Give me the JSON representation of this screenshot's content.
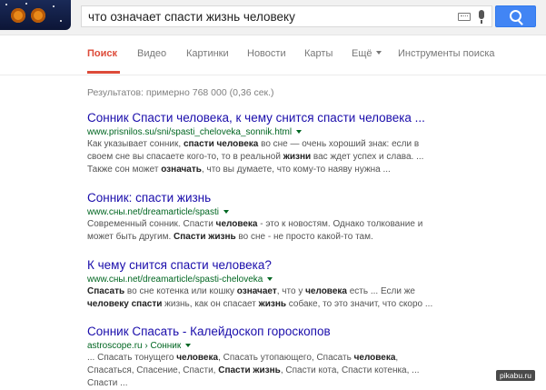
{
  "search": {
    "query": "что означает спасти жизнь человеку"
  },
  "tabs": [
    {
      "label": "Поиск"
    },
    {
      "label": "Видео"
    },
    {
      "label": "Картинки"
    },
    {
      "label": "Новости"
    },
    {
      "label": "Карты"
    },
    {
      "label": "Ещё"
    },
    {
      "label": "Инструменты поиска"
    }
  ],
  "stats": "Результатов: примерно 768 000 (0,36 сек.)",
  "results": [
    {
      "title": "Сонник Спасти человека, к чему снится спасти человека ...",
      "url": "www.prisnilos.su/sni/spasti_cheloveka_sonnik.html",
      "snippet": [
        [
          {
            "t": "Как указывает сонник, "
          },
          {
            "t": "спасти человека",
            "b": true
          },
          {
            "t": " во сне — очень хороший знак: если в"
          }
        ],
        [
          {
            "t": "своем сне вы спасаете кого-то, то в реальной "
          },
          {
            "t": "жизни",
            "b": true
          },
          {
            "t": " вас ждет успех и слава. ..."
          }
        ],
        [
          {
            "t": "Также сон может "
          },
          {
            "t": "означать",
            "b": true
          },
          {
            "t": ", что вы думаете, что кому-то наяву нужна ..."
          }
        ]
      ]
    },
    {
      "title": "Сонник: спасти жизнь",
      "url": "www.сны.net/dreamarticle/spasti",
      "snippet": [
        [
          {
            "t": "Современный сонник. Спасти "
          },
          {
            "t": "человека",
            "b": true
          },
          {
            "t": " - это к новостям. Однако толкование и"
          }
        ],
        [
          {
            "t": "может быть другим. "
          },
          {
            "t": "Спасти жизнь",
            "b": true
          },
          {
            "t": " во сне - не просто какой-то там."
          }
        ]
      ]
    },
    {
      "title": "К чему снится спасти человека?",
      "url": "www.сны.net/dreamarticle/spasti-cheloveka",
      "snippet": [
        [
          {
            "t": "Спасать",
            "b": true
          },
          {
            "t": " во сне котенка или кошку "
          },
          {
            "t": "означает",
            "b": true
          },
          {
            "t": ", что у "
          },
          {
            "t": "человека",
            "b": true
          },
          {
            "t": " есть ... Если же"
          }
        ],
        [
          {
            "t": "человеку спасти",
            "b": true
          },
          {
            "t": " жизнь, как он спасает "
          },
          {
            "t": "жизнь",
            "b": true
          },
          {
            "t": " собаке, то это значит, что скоро ..."
          }
        ]
      ]
    },
    {
      "title": "Сонник Спасать - Калейдоскоп гороскопов",
      "url": "astroscope.ru › Сонник",
      "snippet": [
        [
          {
            "t": "... Спасать тонущего "
          },
          {
            "t": "человека",
            "b": true
          },
          {
            "t": ", Спасать утопающего, Спасать "
          },
          {
            "t": "человека",
            "b": true
          },
          {
            "t": ","
          }
        ],
        [
          {
            "t": "Спасаться, Спасение, Спасти, "
          },
          {
            "t": "Спасти жизнь",
            "b": true
          },
          {
            "t": ", Спасти кота, Спасти котенка, ..."
          }
        ],
        [
          {
            "t": "Спасти ..."
          }
        ]
      ]
    }
  ],
  "watermark": "pikabu.ru"
}
